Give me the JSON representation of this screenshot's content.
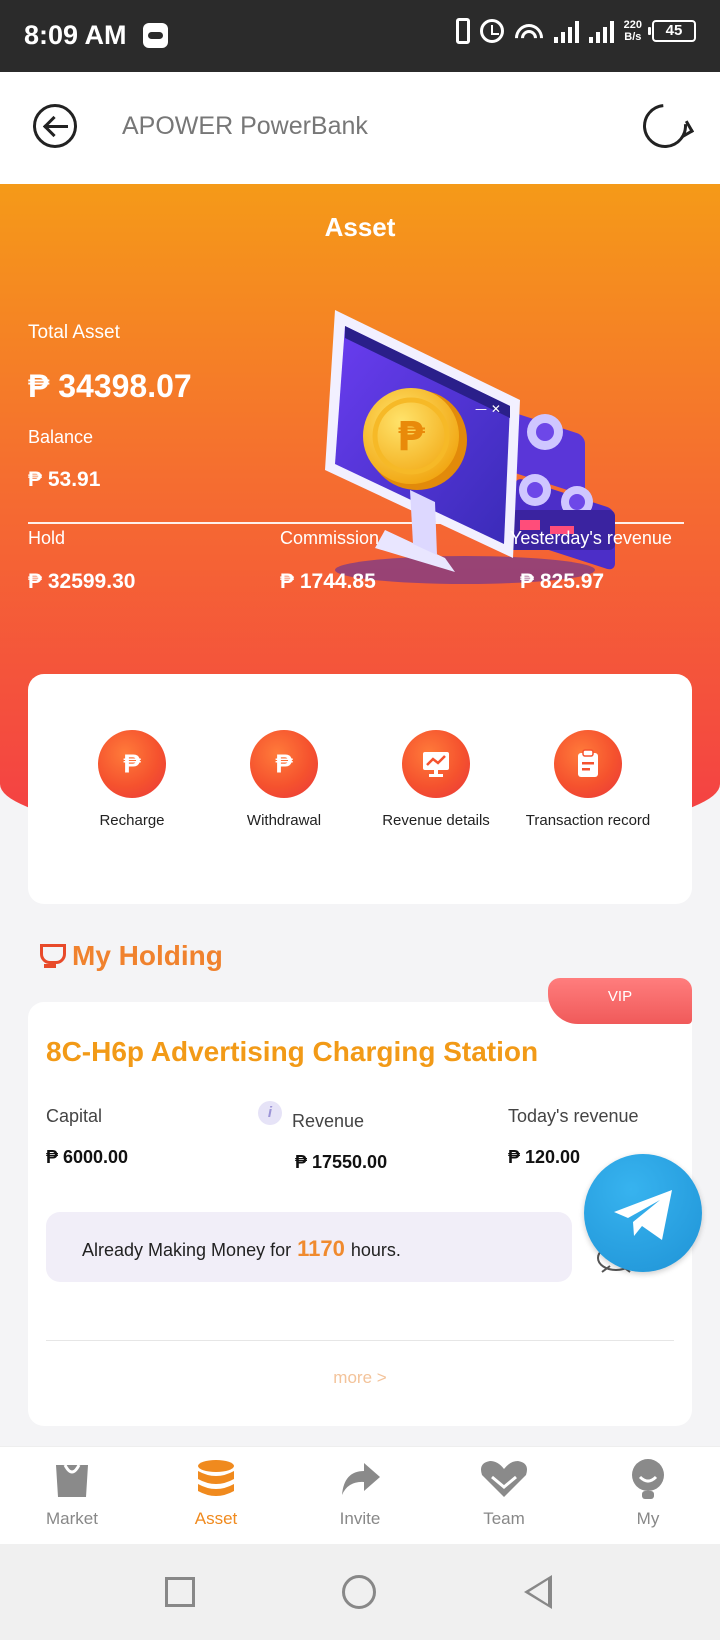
{
  "status_bar": {
    "time": "8:09 AM",
    "net_rate_value": "220",
    "net_rate_unit": "B/s",
    "battery": "45"
  },
  "app_bar": {
    "title": "APOWER PowerBank"
  },
  "asset": {
    "title": "Asset",
    "total_asset_label": "Total Asset",
    "total_asset_value": "₱ 34398.07",
    "balance_label": "Balance",
    "balance_value": "₱ 53.91",
    "hold_label": "Hold",
    "hold_value": "₱ 32599.30",
    "commission_label": "Commission",
    "commission_value": "₱ 1744.85",
    "yesterday_label": "Yesterday's revenue",
    "yesterday_value": "₱ 825.97"
  },
  "actions": [
    {
      "label": "Recharge",
      "icon": "recharge-icon"
    },
    {
      "label": "Withdrawal",
      "icon": "withdrawal-icon"
    },
    {
      "label": "Revenue details",
      "icon": "revenue-details-icon"
    },
    {
      "label": "Transaction record",
      "icon": "transaction-record-icon"
    }
  ],
  "holding": {
    "section_title": "My Holding",
    "badge": "VIP",
    "product_name": "8C-H6p Advertising Charging Station",
    "capital_label": "Capital",
    "capital_value": "₱ 6000.00",
    "revenue_label": "Revenue",
    "revenue_value": "₱ 17550.00",
    "today_label": "Today's revenue",
    "today_value": "₱ 120.00",
    "making_prefix": "Already Making Money for",
    "making_hours": "1170",
    "making_suffix": "hours.",
    "more_link": "more >"
  },
  "bottom_nav": [
    {
      "label": "Market",
      "icon": "market-icon"
    },
    {
      "label": "Asset",
      "icon": "asset-icon",
      "active": true
    },
    {
      "label": "Invite",
      "icon": "invite-icon"
    },
    {
      "label": "Team",
      "icon": "team-icon"
    },
    {
      "label": "My",
      "icon": "my-icon"
    }
  ],
  "colors": {
    "accent": "#f08a1e",
    "hero_top": "#f59a18",
    "hero_bottom": "#f43e45",
    "telegram": "#2aa3e0"
  }
}
